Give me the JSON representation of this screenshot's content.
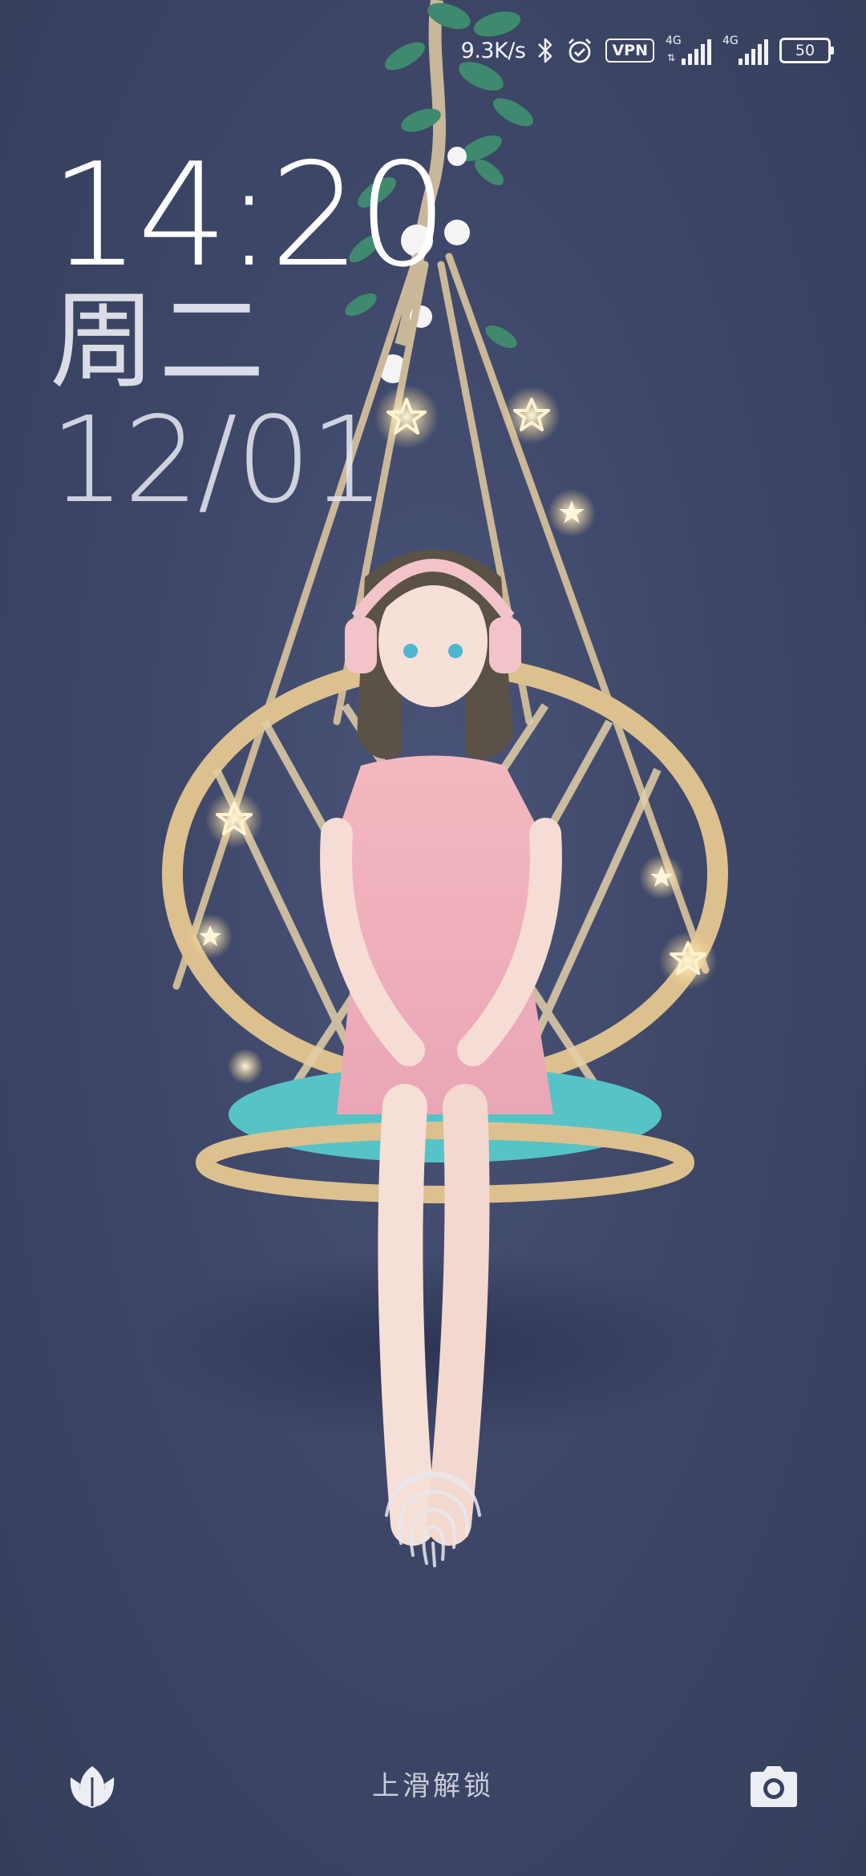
{
  "status_bar": {
    "net_speed": "9.3K/s",
    "vpn_label": "VPN",
    "sim1_network": "4G",
    "sim2_network": "4G",
    "battery_level": "50",
    "icons": [
      "bluetooth-icon",
      "alarm-icon",
      "vpn-icon",
      "signal-icon",
      "signal-icon",
      "battery-icon"
    ]
  },
  "lockscreen": {
    "time": "14:20",
    "weekday": "周二",
    "date": "12/01",
    "unlock_hint": "上滑解锁"
  },
  "shortcuts": {
    "left_icon": "tulip-icon",
    "right_icon": "camera-icon"
  },
  "colors": {
    "background": "#3e4768",
    "text": "#ffffff",
    "hint": "#c9cbd6"
  }
}
